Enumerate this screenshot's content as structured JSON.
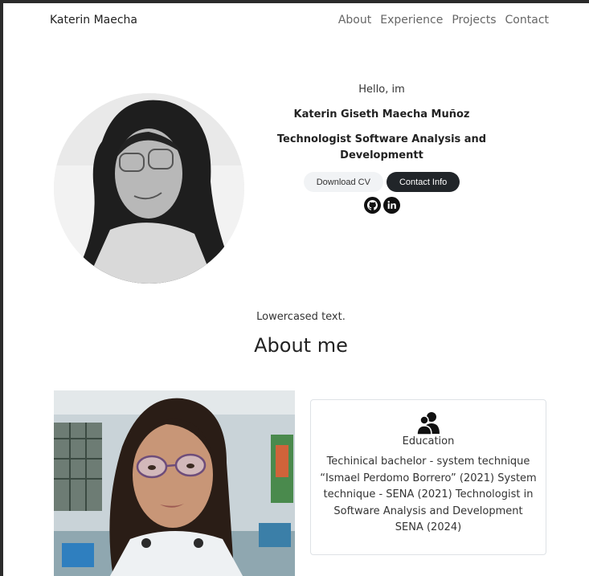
{
  "nav": {
    "brand": "Katerin Maecha",
    "links": [
      "About",
      "Experience",
      "Projects",
      "Contact"
    ]
  },
  "hero": {
    "greeting": "Hello, im",
    "name": "Katerin Giseth Maecha Muñoz",
    "role": "Technologist Software Analysis and Developmentt",
    "download_label": "Download CV",
    "contact_label": "Contact Info",
    "social_icons": [
      "github-icon",
      "linkedin-icon"
    ]
  },
  "about": {
    "note": "Lowercased text.",
    "title": "About me",
    "education": {
      "icon": "people-icon",
      "title": "Education",
      "text": "Techinical bachelor - system technique “Ismael Perdomo Borrero” (2021) System technique - SENA (2021) Technologist in Software Analysis and Development SENA (2024)"
    }
  },
  "colors": {
    "dark_button": "#212529",
    "light_button": "#f1f3f5",
    "nav_link": "#666666"
  }
}
